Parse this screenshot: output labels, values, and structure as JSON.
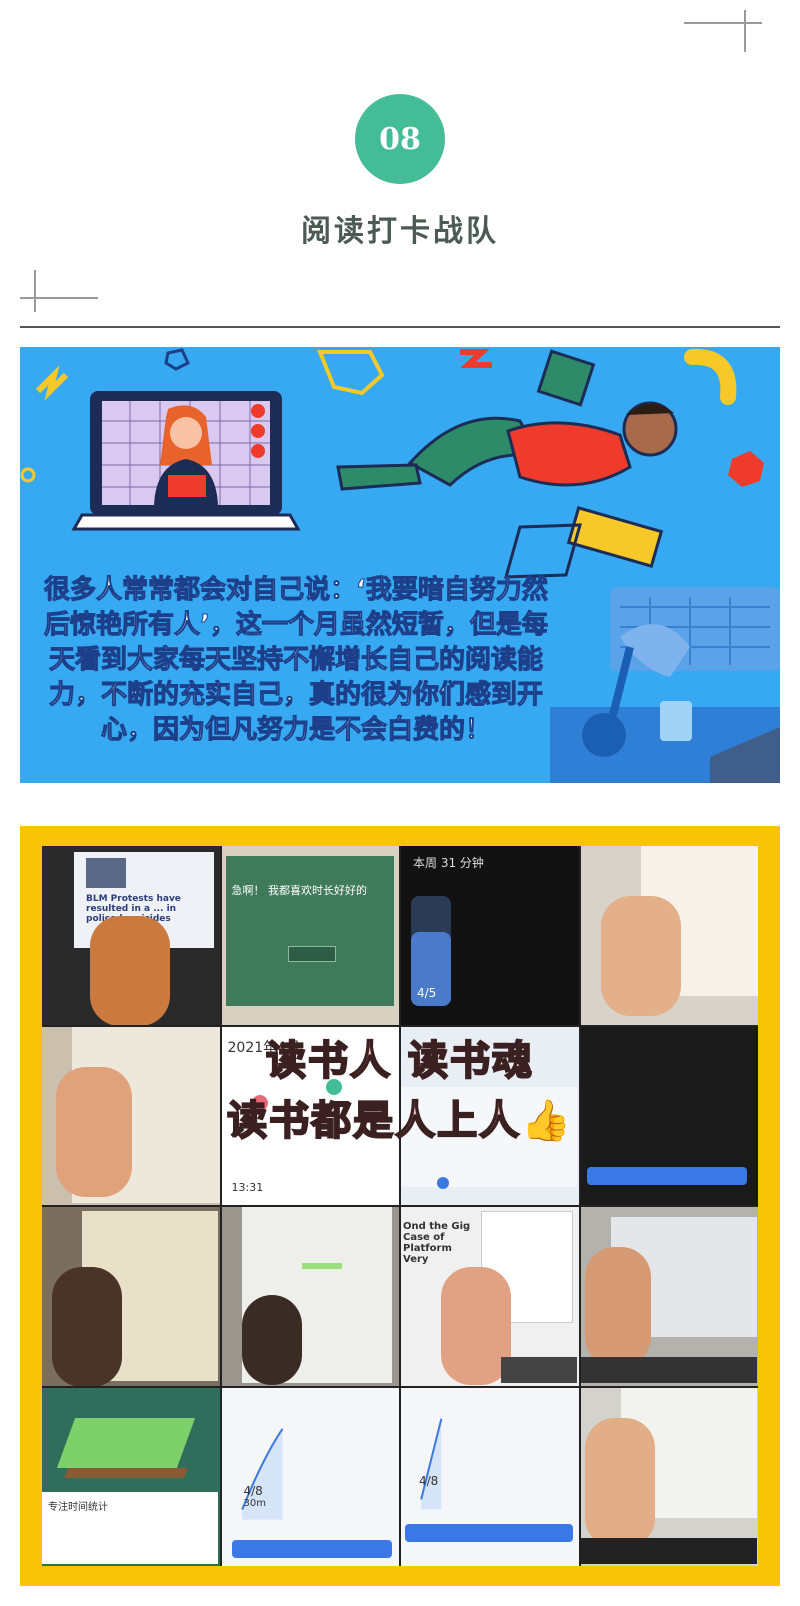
{
  "header": {
    "number_badge": "08",
    "section_title": "阅读打卡战队"
  },
  "banner": {
    "quote": "很多人常常都会对自己说：‘我要暗自努力然后惊艳所有人’，这一个月虽然短暂，但是每天看到大家每天坚持不懈增长自己的阅读能力，不断的充实自己，真的很为你们感到开心，因为但凡努力是不会白费的！"
  },
  "collage": {
    "caption_line1": "读书人 读书魂",
    "caption_line2": "读书都是人上人👍",
    "calendar_title": "2021年4月",
    "calendar_footer_time": "13:31",
    "phone1_header": "本周 31 分钟",
    "phone1_fraction": "4/5",
    "phone2_minutes": "30m",
    "phone2_fraction": "4/8",
    "phone3_fraction": "4/8",
    "news_headline": "BLM Protests have resulted in a ... in police homicides",
    "book_title": "Ond the Gig Case of Platform Very",
    "forest_label": "专注时间统计",
    "chalkboard_text": "急啊！ 我都喜欢时长好好的"
  },
  "colors": {
    "accent": "#44bc96",
    "banner_bg": "#36a9f2",
    "frame": "#f9c406"
  }
}
